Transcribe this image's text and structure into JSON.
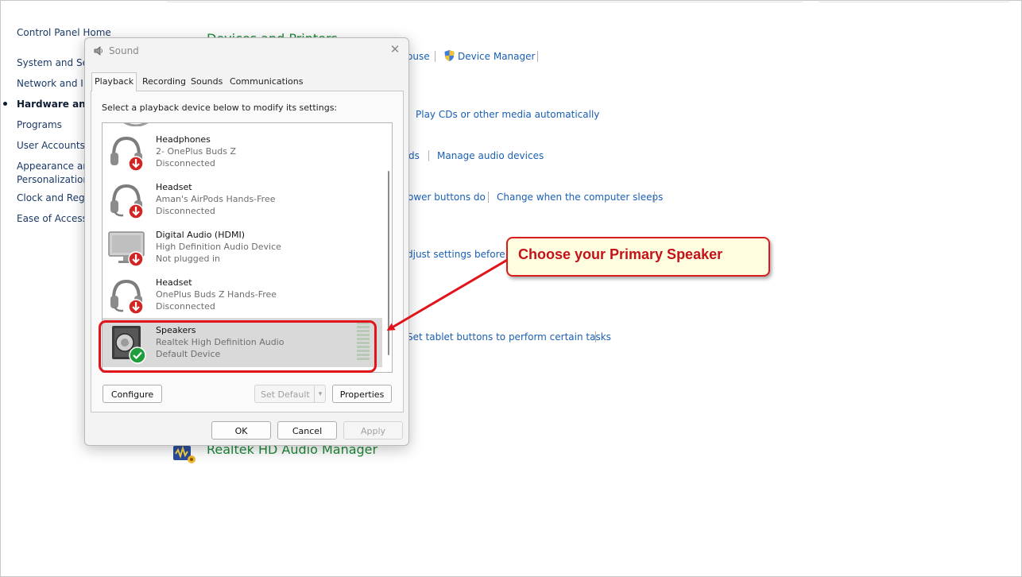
{
  "control_panel": {
    "nav": {
      "home": "Control Panel Home",
      "items": [
        "System and Sec",
        "Network and Int",
        "Hardware and S",
        "Programs",
        "User Accounts",
        "Appearance and",
        "Personalization",
        "Clock and Regio",
        "Ease of Access"
      ]
    },
    "main": {
      "devices_title_fragment": "Devices and Printers",
      "mouse_link": "ouse",
      "device_manager_link": "Device Manager",
      "autoplay_link": "Play CDs or other media automatically",
      "sounds_link_fragment": "ds",
      "manage_audio_link": "Manage audio devices",
      "power_link_fragment": "ower buttons do",
      "sleep_link": "Change when the computer sleeps",
      "adjust_link_fragment": "djust settings before gi",
      "tablet_link": "Set tablet buttons to perform certain tasks",
      "realtek_title": "Realtek HD Audio Manager"
    }
  },
  "dialog": {
    "title": "Sound",
    "close_glyph": "✕",
    "tabs": [
      {
        "label": "Playback",
        "active": true
      },
      {
        "label": "Recording"
      },
      {
        "label": "Sounds"
      },
      {
        "label": "Communications"
      }
    ],
    "instruction": "Select a playback device below to modify its settings:",
    "devices": [
      {
        "name": "Headphones",
        "sub": "2- OnePlus Buds Z",
        "status": "Disconnected",
        "icon": "headphones-icon",
        "badge": "disconnected-arrow-icon"
      },
      {
        "name": "Headset",
        "sub": "Aman's AirPods Hands-Free",
        "status": "Disconnected",
        "icon": "headset-icon",
        "badge": "disconnected-arrow-icon"
      },
      {
        "name": "Digital Audio (HDMI)",
        "sub": "High Definition Audio Device",
        "status": "Not plugged in",
        "icon": "monitor-icon",
        "badge": "disconnected-arrow-icon"
      },
      {
        "name": "Headset",
        "sub": "OnePlus Buds Z Hands-Free",
        "status": "Disconnected",
        "icon": "headset-icon",
        "badge": "disconnected-arrow-icon"
      },
      {
        "name": "Speakers",
        "sub": "Realtek High Definition Audio",
        "status": "Default Device",
        "icon": "speaker-icon",
        "badge": "default-check-icon",
        "selected": true
      }
    ],
    "buttons": {
      "configure": "Configure",
      "set_default": "Set Default",
      "dropdown_glyph": "▾",
      "properties": "Properties",
      "ok": "OK",
      "cancel": "Cancel",
      "apply": "Apply"
    }
  },
  "annotation": {
    "callout_text": "Choose your Primary Speaker",
    "color": "#e0141a"
  }
}
